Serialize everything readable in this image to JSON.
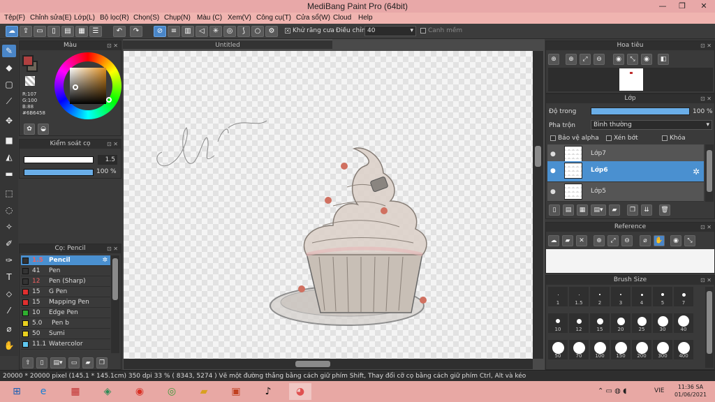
{
  "app": {
    "title": "MediBang Paint Pro (64bit)",
    "win_min": "—",
    "win_max": "❐",
    "win_close": "✕"
  },
  "menu": [
    "Tệp(F)",
    "Chỉnh sửa(E)",
    "Lớp(L)",
    "Bộ lọc(R)",
    "Chọn(S)",
    "Chụp(N)",
    "Màu (C)",
    "Xem(V)",
    "Công cụ(T)",
    "Cửa sổ(W)",
    "Cloud",
    "Help"
  ],
  "toolbar": {
    "antialias_label": "Khử răng cưa",
    "adjust_label": "Điều chỉnh",
    "adjust_value": "40",
    "smooth_label": "Canh mềm"
  },
  "color_panel": {
    "title": "Màu",
    "r": "R:107",
    "g": "G:100",
    "b": "B:88",
    "hex": "#6B6458",
    "colors": {
      "fg": "#b04040",
      "current": "#6b6458"
    }
  },
  "brush_control": {
    "title": "Kiểm soát cọ",
    "size": "1.5",
    "opacity": "100 %"
  },
  "brush_list": {
    "title": "Cọ: Pencil",
    "items": [
      {
        "size": "1.5",
        "name": "Pencil",
        "color": "#333333",
        "selected": true
      },
      {
        "size": "41",
        "name": "Pen",
        "color": "#333333"
      },
      {
        "size": "12",
        "name": "Pen (Sharp)",
        "color": "#333333"
      },
      {
        "size": "15",
        "name": "G Pen",
        "color": "#e03030"
      },
      {
        "size": "15",
        "name": "Mapping Pen",
        "color": "#e03030"
      },
      {
        "size": "10",
        "name": "Edge Pen",
        "color": "#30b030"
      },
      {
        "size": "5.0",
        "name": "Pen b",
        "color": "#e8d020"
      },
      {
        "size": "50",
        "name": "Sumi",
        "color": "#e8d020"
      },
      {
        "size": "11.1",
        "name": "Watercolor",
        "color": "#60c8f0"
      }
    ]
  },
  "canvas": {
    "tab": "Untitled"
  },
  "navigator": {
    "title": "Hoa tiêu"
  },
  "layers": {
    "title": "Lớp",
    "opacity_label": "Độ trong",
    "opacity_value": "100 %",
    "opacity_fraction": 1.0,
    "blend_label": "Pha trộn",
    "blend_value": "Bình thường",
    "protect_alpha": "Bảo vệ alpha",
    "clipping": "Xén bớt",
    "lock": "Khóa",
    "items": [
      {
        "name": "Lớp7"
      },
      {
        "name": "Lớp6",
        "selected": true
      },
      {
        "name": "Lớp5"
      }
    ]
  },
  "reference": {
    "title": "Reference"
  },
  "brush_size": {
    "title": "Brush Size",
    "sizes": [
      "1",
      "1.5",
      "2",
      "3",
      "4",
      "5",
      "7",
      "10",
      "12",
      "15",
      "20",
      "25",
      "30",
      "40",
      "50",
      "70",
      "100",
      "150",
      "200",
      "300",
      "400"
    ]
  },
  "status": {
    "text": "20000 * 20000 pixel   (145.1 * 145.1cm)   350 dpi   33 %   ( 8343, 5274 )   Vẽ một đường thẳng bằng cách giữ phím Shift, Thay đổi cỡ cọ bằng cách giữ phím Ctrl, Alt và kéo"
  },
  "taskbar": {
    "lang": "VIE",
    "time": "11:36 SA",
    "date": "01/06/2021"
  }
}
